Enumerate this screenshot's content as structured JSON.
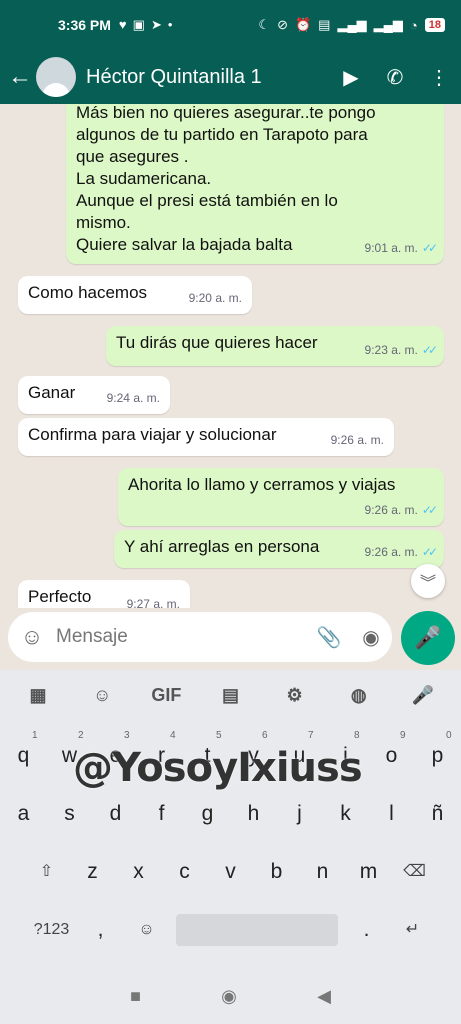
{
  "status": {
    "time": "3:36 PM",
    "left_icons": [
      "heart-icon",
      "ad-icon",
      "telegram-icon",
      "more-icon"
    ],
    "battery": "18"
  },
  "header": {
    "contact_name": "Héctor Quintanilla 1"
  },
  "messages": [
    {
      "dir": "out",
      "text": "Más bien no quieres asegurar..te pongo\nalgunos de tu partido en Tarapoto para\nque asegures .\nLa sudamericana.\nAunque el presi está también en lo\nmismo.\nQuiere salvar la bajada balta",
      "time": "9:01 a. m.",
      "read": true
    },
    {
      "dir": "in",
      "text": "Como hacemos",
      "time": "9:20 a. m."
    },
    {
      "dir": "out",
      "text": "Tu dirás que quieres hacer",
      "time": "9:23 a. m.",
      "read": true
    },
    {
      "dir": "in",
      "text": "Ganar",
      "time": "9:24 a. m."
    },
    {
      "dir": "in",
      "text": "Confirma para viajar y solucionar",
      "time": "9:26 a. m."
    },
    {
      "dir": "out",
      "text": "Ahorita lo llamo y cerramos y viajas",
      "time": "9:26 a. m.",
      "read": true
    },
    {
      "dir": "out",
      "text": "Y ahí arreglas en persona",
      "time": "9:26 a. m.",
      "read": true
    },
    {
      "dir": "in",
      "text": "Perfecto",
      "time": "9:27 a. m."
    }
  ],
  "input": {
    "placeholder": "Mensaje"
  },
  "keyboard": {
    "toolbar": [
      "apps-icon",
      "sticker-icon",
      "GIF",
      "clipboard-icon",
      "settings-icon",
      "palette-icon",
      "mic-icon"
    ],
    "row1": [
      [
        "q",
        "1"
      ],
      [
        "w",
        "2"
      ],
      [
        "e",
        "3"
      ],
      [
        "r",
        "4"
      ],
      [
        "t",
        "5"
      ],
      [
        "y",
        "6"
      ],
      [
        "u",
        "7"
      ],
      [
        "i",
        "8"
      ],
      [
        "o",
        "9"
      ],
      [
        "p",
        "0"
      ]
    ],
    "row2": [
      "a",
      "s",
      "d",
      "f",
      "g",
      "h",
      "j",
      "k",
      "l",
      "ñ"
    ],
    "row3": [
      "z",
      "x",
      "c",
      "v",
      "b",
      "n",
      "m"
    ],
    "row4_symbols": "?123",
    "row4_comma": ",",
    "row4_period": ".",
    "watermark": "@YosoyIxiuss"
  },
  "colors": {
    "header": "#075e54",
    "outgoing_bubble": "#dcf8c6",
    "incoming_bubble": "#ffffff",
    "accent": "#00a884",
    "read_ticks": "#4fc3f7"
  }
}
